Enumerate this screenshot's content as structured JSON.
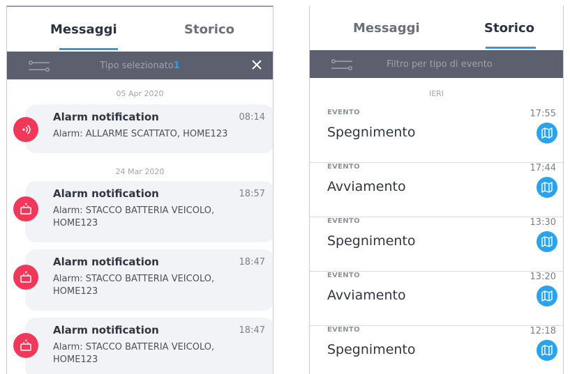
{
  "left": {
    "tabs": {
      "messages": "Messaggi",
      "history": "Storico"
    },
    "filter": {
      "text": "Tipo selezionato",
      "count": "1"
    },
    "groups": [
      {
        "date": "05 Apr 2020"
      },
      {
        "date": "24 Mar 2020"
      }
    ],
    "messages": [
      {
        "title": "Alarm notification",
        "time": "08:14",
        "body": "Alarm: ALLARME SCATTATO, HOME123",
        "icon": "alarm-signal-icon"
      },
      {
        "title": "Alarm notification",
        "time": "18:57",
        "body": "Alarm: STACCO BATTERIA VEICOLO, HOME123",
        "icon": "battery-icon"
      },
      {
        "title": "Alarm notification",
        "time": "18:47",
        "body": "Alarm: STACCO BATTERIA VEICOLO, HOME123",
        "icon": "battery-icon"
      },
      {
        "title": "Alarm notification",
        "time": "18:47",
        "body": "Alarm: STACCO BATTERIA VEICOLO, HOME123",
        "icon": "battery-icon"
      }
    ]
  },
  "right": {
    "tabs": {
      "messages": "Messaggi",
      "history": "Storico"
    },
    "filter": {
      "placeholder": "Filtro per tipo di evento"
    },
    "group": "IERI",
    "events": [
      {
        "label": "EVENTO",
        "time": "17:55",
        "name": "Spegnimento"
      },
      {
        "label": "EVENTO",
        "time": "17:44",
        "name": "Avviamento"
      },
      {
        "label": "EVENTO",
        "time": "13:30",
        "name": "Spegnimento"
      },
      {
        "label": "EVENTO",
        "time": "13:20",
        "name": "Avviamento"
      },
      {
        "label": "EVENTO",
        "time": "12:18",
        "name": "Spegnimento"
      }
    ]
  },
  "colors": {
    "accent": "#2c9be6",
    "alarm": "#f2385a",
    "filter_bar": "#5b5f6e",
    "map_button": "#29a3ea"
  }
}
